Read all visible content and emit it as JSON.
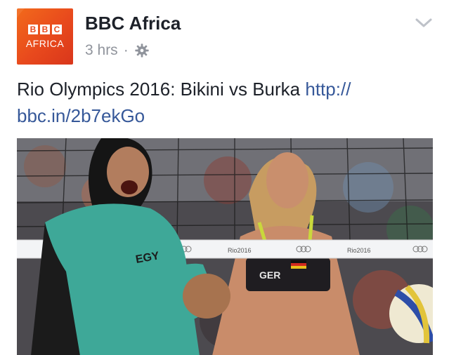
{
  "post": {
    "page_name": "BBC Africa",
    "avatar": {
      "blocks": [
        "B",
        "B",
        "C"
      ],
      "label": "AFRICA"
    },
    "timestamp": "3 hrs",
    "separator": "·",
    "privacy_icon": "gear-icon",
    "menu_icon": "chevron-down-icon",
    "text": "Rio Olympics 2016: Bikini vs Burka",
    "link": "http://bbc.in/2b7ekGo",
    "link_line1": "http://",
    "link_line2": "bbc.in/2b7ekGo"
  },
  "photo": {
    "jersey_left": "EGY",
    "jersey_right": "GER",
    "net_logo": "Rio2016"
  },
  "colors": {
    "link": "#365899",
    "meta": "#90949c",
    "brand": "#e8491d",
    "left_outfit": "#3ea898",
    "top_right": "#2a2a2e"
  }
}
